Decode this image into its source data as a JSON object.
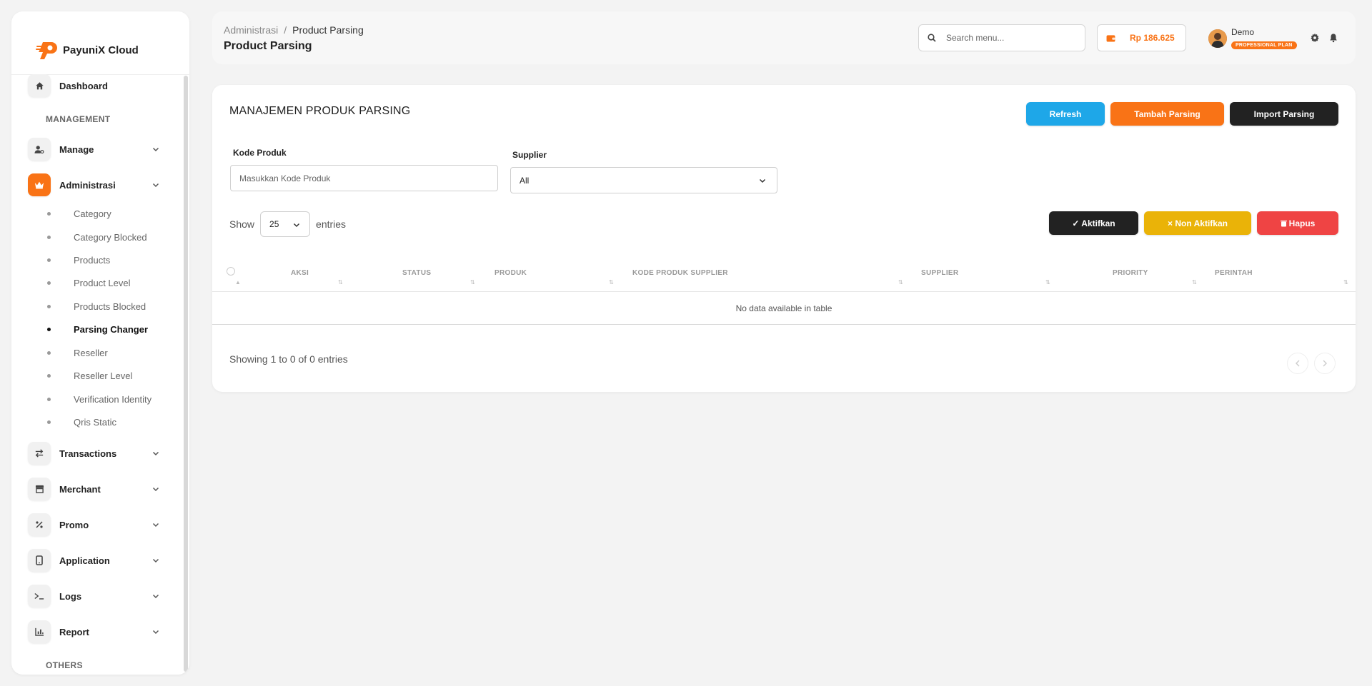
{
  "brand": {
    "name": "PayuniX Cloud"
  },
  "sidebar": {
    "items_top": [
      {
        "label": "Dashboard",
        "icon": "home-icon"
      }
    ],
    "section_management": "MANAGEMENT",
    "manage": {
      "label": "Manage",
      "icon": "user-gear-icon"
    },
    "administrasi": {
      "label": "Administrasi",
      "icon": "crown-icon"
    },
    "sub_items": [
      {
        "label": "Category"
      },
      {
        "label": "Category Blocked"
      },
      {
        "label": "Products"
      },
      {
        "label": "Product Level"
      },
      {
        "label": "Products Blocked"
      },
      {
        "label": "Parsing Changer",
        "active": true
      },
      {
        "label": "Reseller"
      },
      {
        "label": "Reseller Level"
      },
      {
        "label": "Verification Identity"
      },
      {
        "label": "Qris Static"
      }
    ],
    "groups": [
      {
        "label": "Transactions",
        "icon": "arrows-swap-icon"
      },
      {
        "label": "Merchant",
        "icon": "store-icon"
      },
      {
        "label": "Promo",
        "icon": "percent-icon"
      },
      {
        "label": "Application",
        "icon": "mobile-icon"
      },
      {
        "label": "Logs",
        "icon": "terminal-icon"
      },
      {
        "label": "Report",
        "icon": "chart-icon"
      }
    ],
    "section_others": "OTHERS"
  },
  "header": {
    "breadcrumb": [
      "Administrasi",
      "Product Parsing"
    ],
    "breadcrumb_sep": "/",
    "title": "Product Parsing",
    "search_placeholder": "Search menu...",
    "balance": "Rp 186.625",
    "user_name": "Demo",
    "plan": "PROFESSIONAL PLAN"
  },
  "card": {
    "title": "MANAJEMEN PRODUK PARSING",
    "buttons": {
      "refresh": "Refresh",
      "add": "Tambah Parsing",
      "import": "Import Parsing"
    },
    "filters": {
      "kode_label": "Kode Produk",
      "kode_placeholder": "Masukkan Kode Produk",
      "supplier_label": "Supplier",
      "supplier_value": "All"
    },
    "show": {
      "prefix": "Show",
      "value": "25",
      "suffix": "entries"
    },
    "bulk": {
      "activate": "✓ Aktifkan",
      "deactivate": "× Non Aktifkan",
      "delete": "Hapus"
    },
    "columns": [
      "AKSI",
      "STATUS",
      "PRODUK",
      "KODE PRODUK SUPPLIER",
      "SUPPLIER",
      "PRIORITY",
      "PERINTAH"
    ],
    "empty": "No data available in table",
    "info": "Showing 1 to 0 of 0 entries"
  },
  "colors": {
    "accent": "#f97316",
    "refresh": "#1ea7e8",
    "dark": "#222222",
    "warning": "#eab308",
    "danger": "#ef4444"
  }
}
